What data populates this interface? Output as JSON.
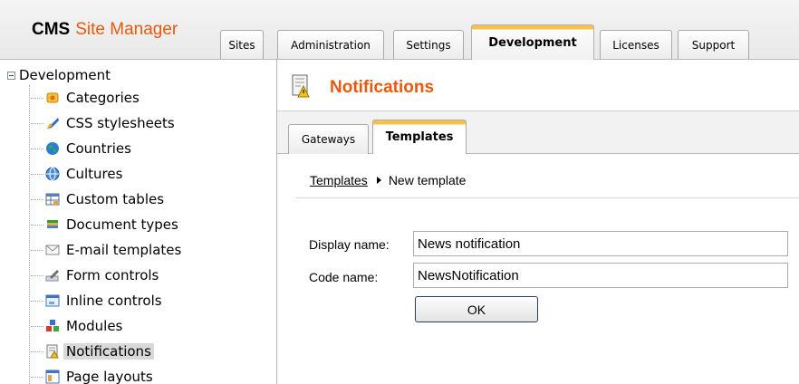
{
  "app": {
    "logo_bold": "CMS",
    "logo_name": "Site Manager"
  },
  "top_tabs": [
    {
      "label": "Sites",
      "active": false
    },
    {
      "label": "Administration",
      "active": false
    },
    {
      "label": "Settings",
      "active": false
    },
    {
      "label": "Development",
      "active": true
    },
    {
      "label": "Licenses",
      "active": false
    },
    {
      "label": "Support",
      "active": false
    }
  ],
  "sidebar": {
    "root": "Development",
    "items": [
      {
        "label": "Categories",
        "icon": "categories-icon"
      },
      {
        "label": "CSS stylesheets",
        "icon": "css-stylesheets-icon"
      },
      {
        "label": "Countries",
        "icon": "globe-icon"
      },
      {
        "label": "Cultures",
        "icon": "cultures-globe-icon"
      },
      {
        "label": "Custom tables",
        "icon": "table-icon"
      },
      {
        "label": "Document types",
        "icon": "document-types-icon"
      },
      {
        "label": "E-mail templates",
        "icon": "envelope-icon"
      },
      {
        "label": "Form controls",
        "icon": "form-controls-icon"
      },
      {
        "label": "Inline controls",
        "icon": "inline-controls-icon"
      },
      {
        "label": "Modules",
        "icon": "modules-icon"
      },
      {
        "label": "Notifications",
        "icon": "notifications-icon",
        "selected": true
      },
      {
        "label": "Page layouts",
        "icon": "page-layouts-icon"
      }
    ]
  },
  "main": {
    "title": "Notifications",
    "tabs": [
      {
        "label": "Gateways",
        "active": false
      },
      {
        "label": "Templates",
        "active": true
      }
    ],
    "breadcrumb": {
      "link": "Templates",
      "current": "New template"
    },
    "form": {
      "display_name_label": "Display name:",
      "display_name_value": "News notification",
      "code_name_label": "Code name:",
      "code_name_value": "NewsNotification",
      "ok_label": "OK"
    }
  },
  "colors": {
    "accent": "#e8590c",
    "active_tab_top": "#f8c24a"
  }
}
